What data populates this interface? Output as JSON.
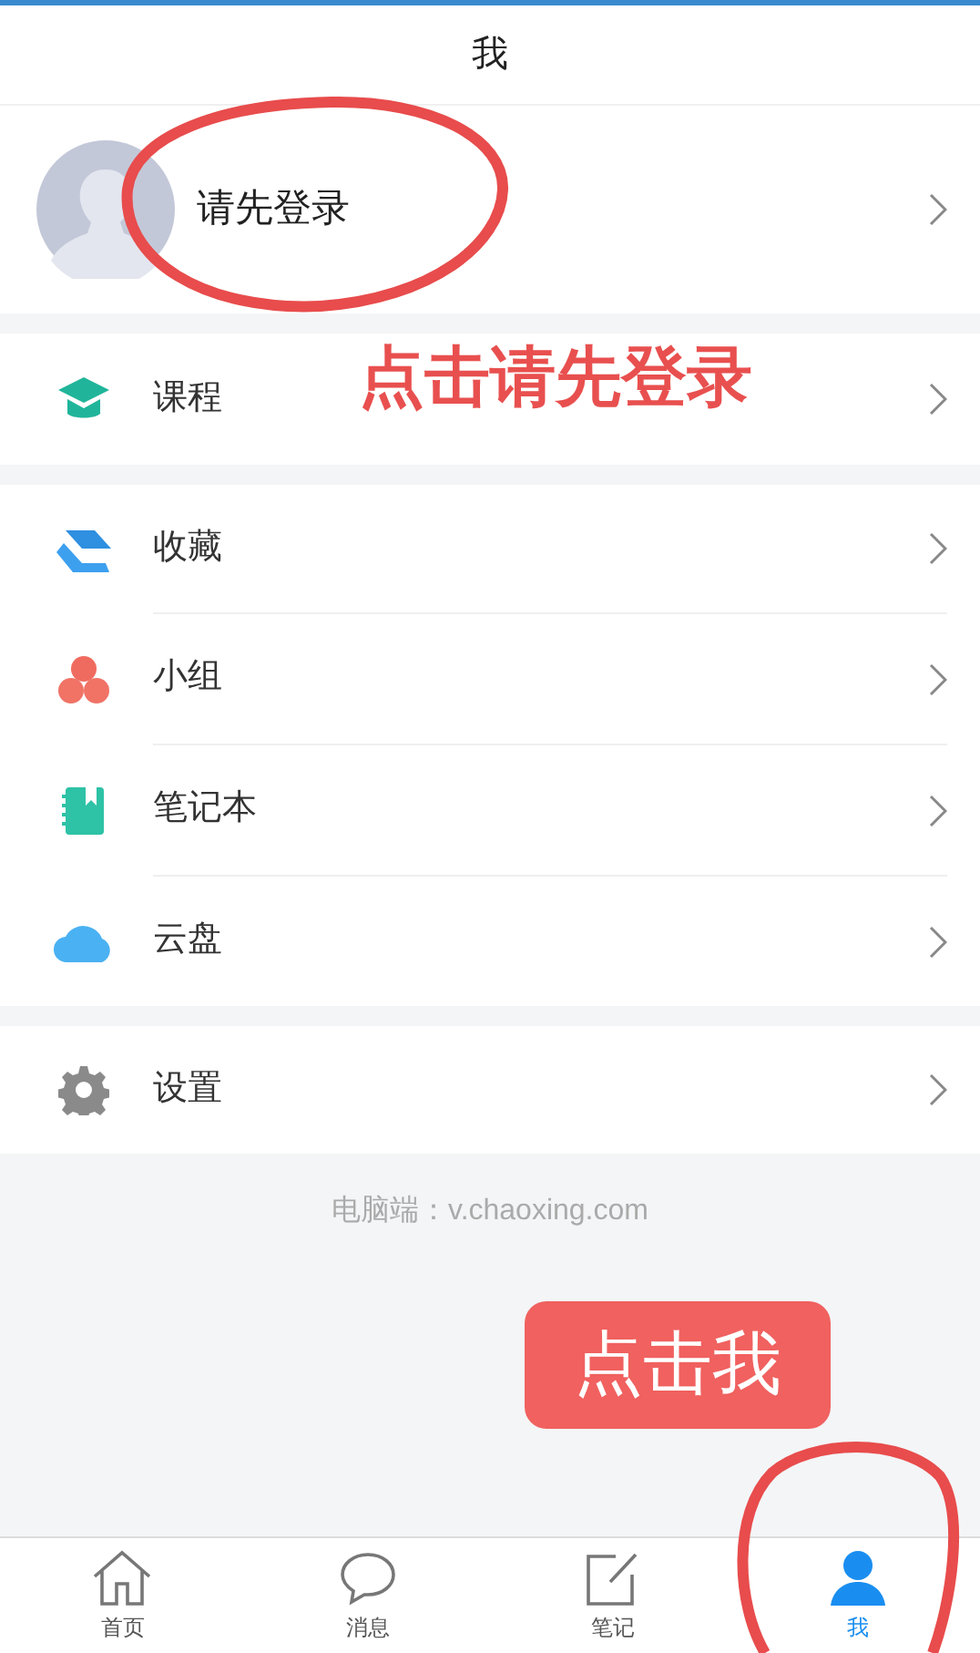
{
  "header": {
    "title": "我"
  },
  "profile": {
    "label": "请先登录"
  },
  "menu_groups": [
    {
      "items": [
        {
          "label": "课程"
        }
      ]
    },
    {
      "items": [
        {
          "label": "收藏"
        },
        {
          "label": "小组"
        },
        {
          "label": "笔记本"
        },
        {
          "label": "云盘"
        }
      ]
    },
    {
      "items": [
        {
          "label": "设置"
        }
      ]
    }
  ],
  "footer_note": "电脑端：v.chaoxing.com",
  "annotation_text": "点击请先登录",
  "annotation_badge": "点击我",
  "tabs": [
    {
      "label": "首页",
      "selected": false
    },
    {
      "label": "消息",
      "selected": false
    },
    {
      "label": "笔记",
      "selected": false
    },
    {
      "label": "我",
      "selected": true
    }
  ]
}
